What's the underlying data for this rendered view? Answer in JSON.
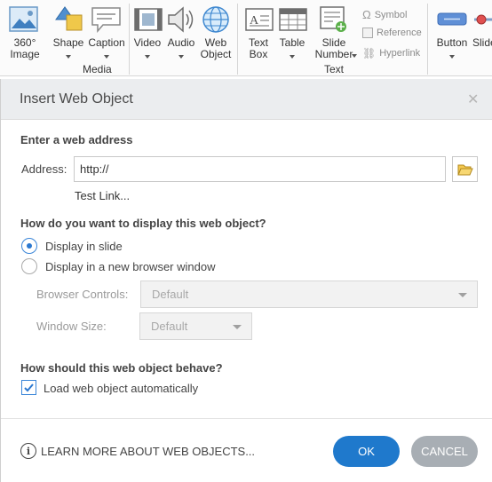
{
  "ribbon": {
    "items": [
      {
        "label": "360° Image",
        "icon": "360-image-icon"
      },
      {
        "label": "Shape",
        "icon": "shape-icon"
      },
      {
        "label": "Caption",
        "icon": "caption-icon"
      },
      {
        "label": "Video",
        "icon": "video-icon"
      },
      {
        "label": "Audio",
        "icon": "audio-icon"
      },
      {
        "label": "Web Object",
        "icon": "web-object-icon"
      },
      {
        "label": "Text Box",
        "icon": "text-box-icon"
      },
      {
        "label": "Table",
        "icon": "table-icon"
      },
      {
        "label": "Slide Number",
        "icon": "slide-number-icon"
      },
      {
        "label": "Button",
        "icon": "button-icon"
      },
      {
        "label": "Slider",
        "icon": "slider-icon"
      }
    ],
    "small_items": [
      "Symbol",
      "Reference",
      "Hyperlink"
    ],
    "groups": [
      "Media",
      "Text"
    ]
  },
  "dialog": {
    "title": "Insert Web Object",
    "section_address": "Enter a web address",
    "address_label": "Address:",
    "address_value": "http://",
    "test_link": "Test Link...",
    "section_display": "How do you want to display this web object?",
    "radio_slide": "Display in slide",
    "radio_browser": "Display in a new browser window",
    "browser_controls_label": "Browser Controls:",
    "browser_controls_value": "Default",
    "window_size_label": "Window Size:",
    "window_size_value": "Default",
    "section_behave": "How should this web object behave?",
    "load_auto_label": "Load web object automatically",
    "load_auto_checked": true,
    "learn_more": "LEARN MORE ABOUT WEB OBJECTS...",
    "ok": "OK",
    "cancel": "CANCEL"
  },
  "colors": {
    "accent": "#1f79cc",
    "cancel": "#a8aeb4"
  }
}
